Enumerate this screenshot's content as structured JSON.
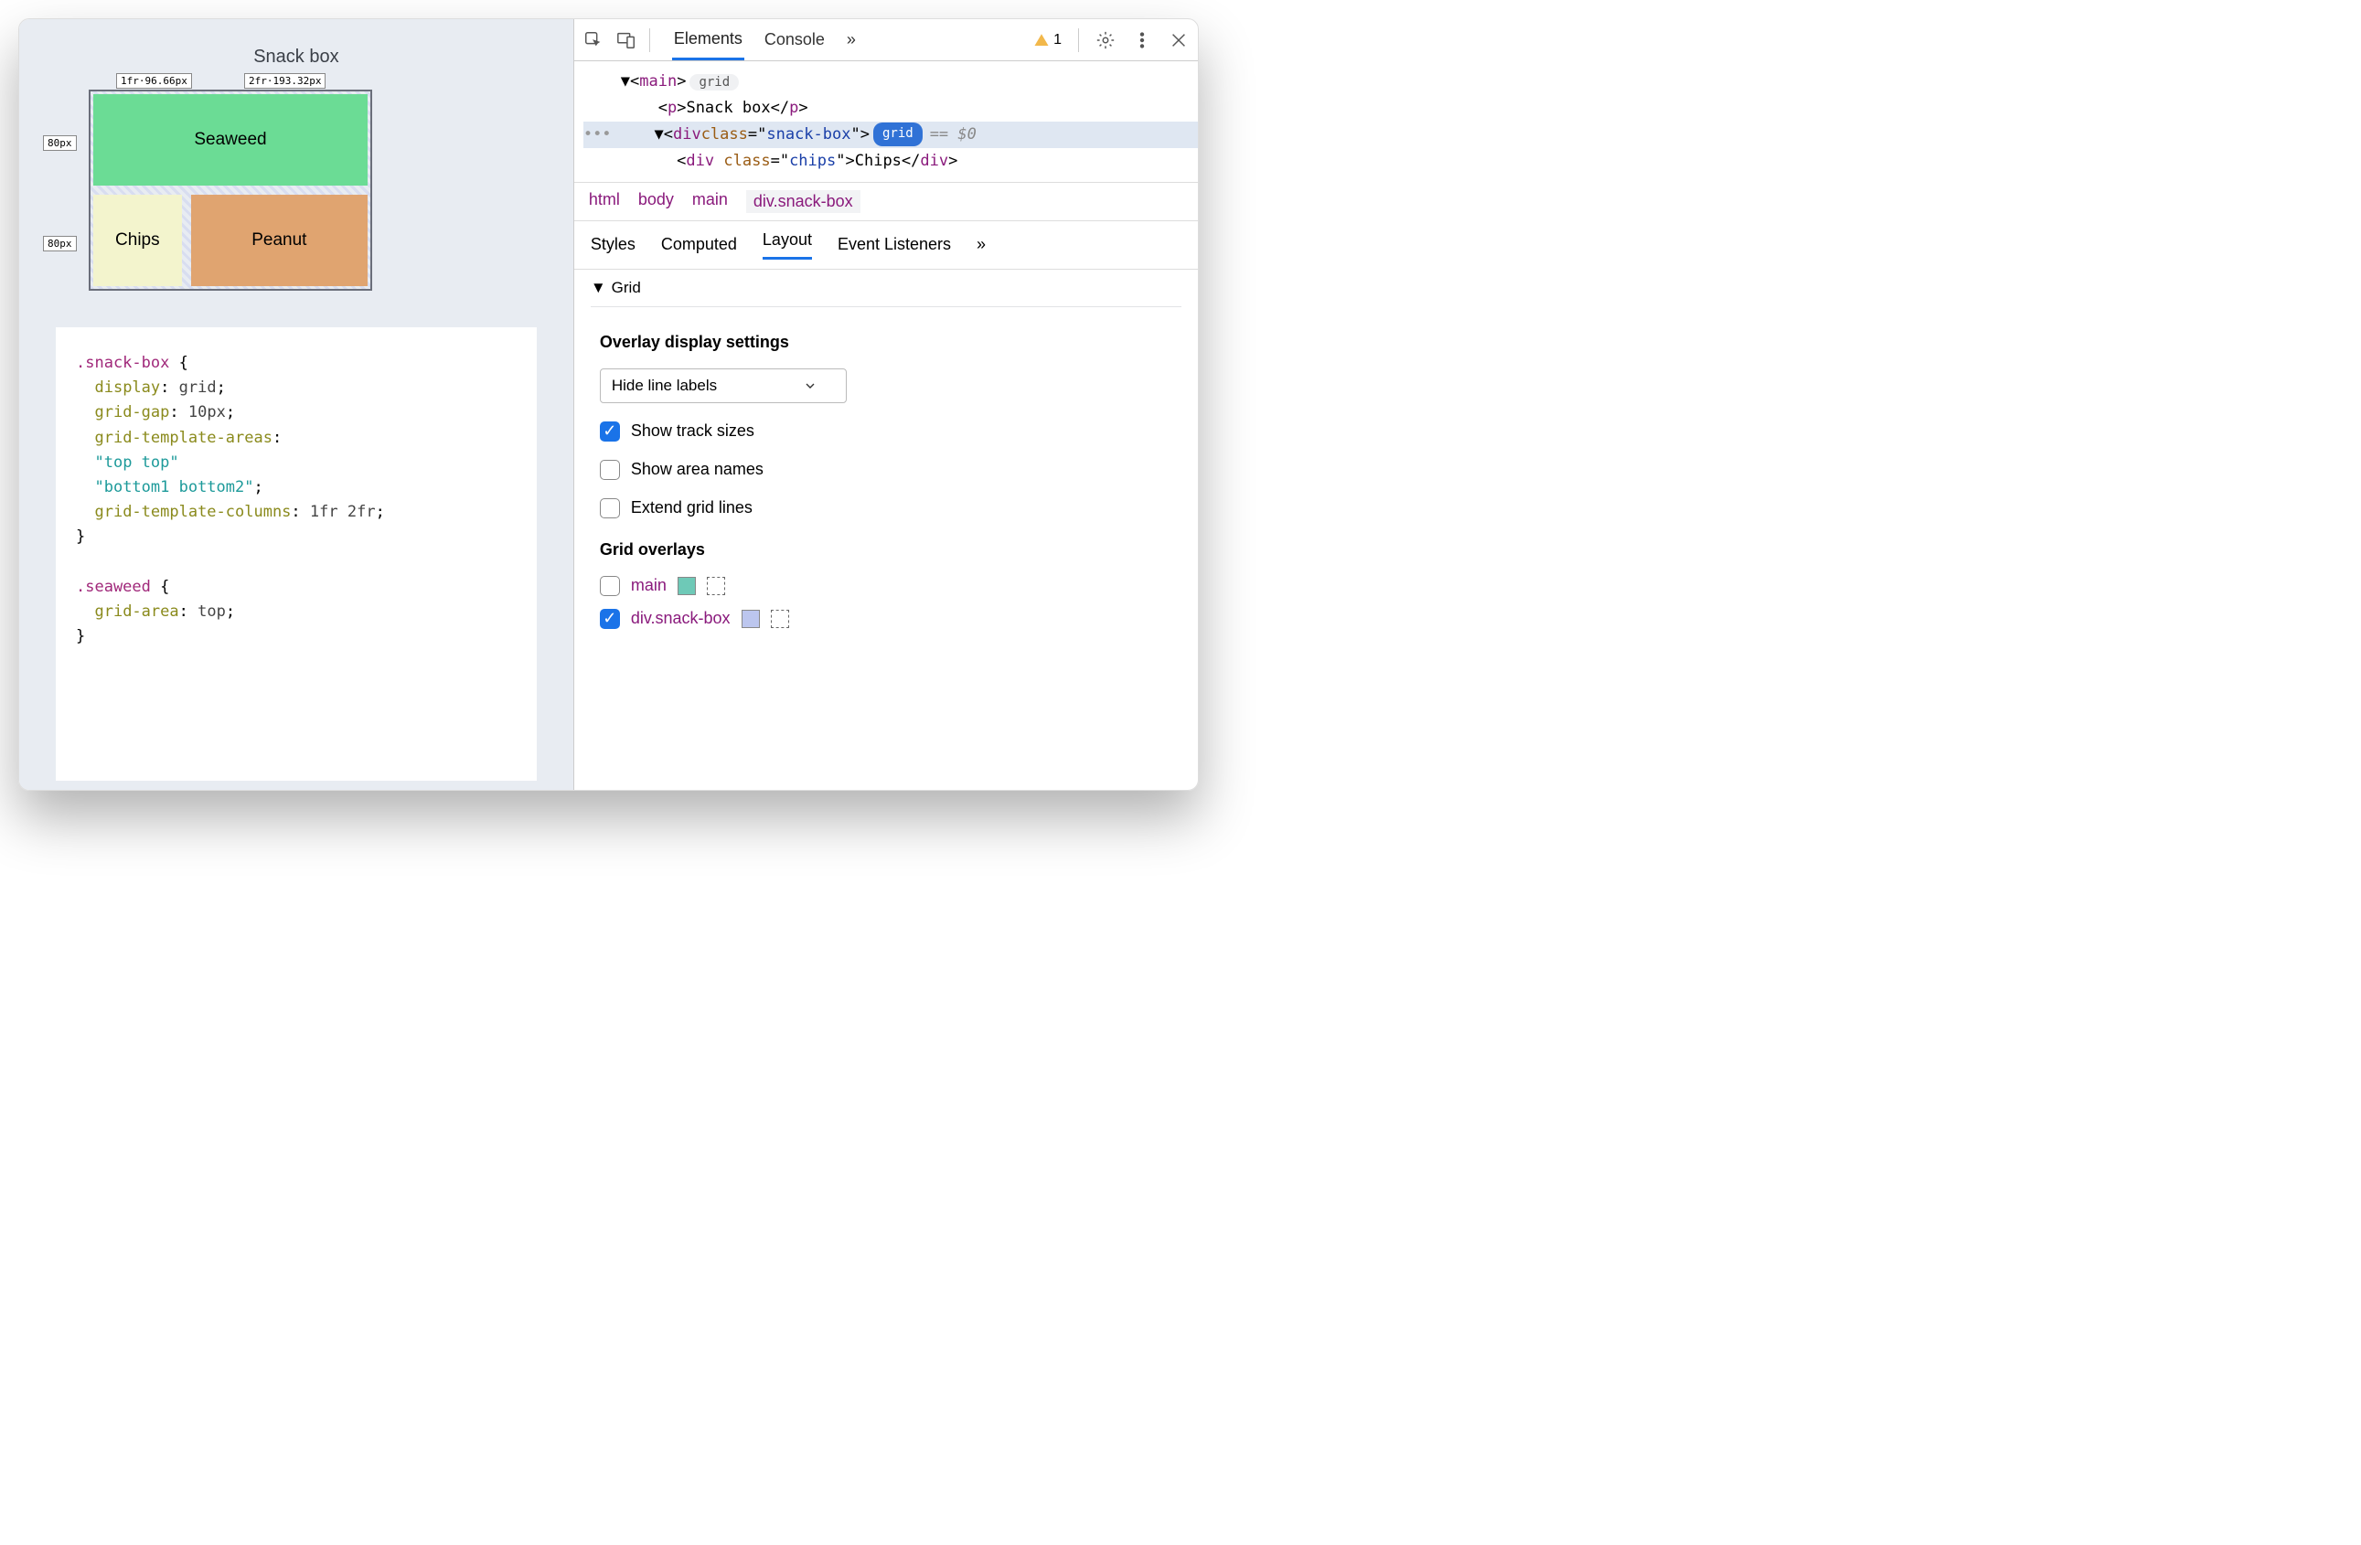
{
  "preview": {
    "title": "Snack box",
    "tracks": {
      "col1": "1fr·96.66px",
      "col2": "2fr·193.32px",
      "row1": "80px",
      "row2": "80px"
    },
    "cells": {
      "seaweed": "Seaweed",
      "chips": "Chips",
      "peanut": "Peanut"
    }
  },
  "css": {
    "selector1": ".snack-box",
    "l1p": "display",
    "l1v": "grid",
    "l2p": "grid-gap",
    "l2v": "10px",
    "l3p": "grid-template-areas",
    "l4": "\"top top\"",
    "l5": "\"bottom1 bottom2\"",
    "l6p": "grid-template-columns",
    "l6v": "1fr 2fr",
    "selector2": ".seaweed",
    "l7p": "grid-area",
    "l7v": "top"
  },
  "toolbar": {
    "tabs": {
      "elements": "Elements",
      "console": "Console"
    },
    "more": "»",
    "warn_count": "1"
  },
  "dom": {
    "main_open": "main",
    "main_badge": "grid",
    "p_text": "Snack box",
    "div_class": "snack-box",
    "div_badge": "grid",
    "selvar": "== $0",
    "child_class": "chips",
    "child_text": "Chips"
  },
  "crumbs": {
    "c1": "html",
    "c2": "body",
    "c3": "main",
    "c4": "div.snack-box"
  },
  "panetabs": {
    "t1": "Styles",
    "t2": "Computed",
    "t3": "Layout",
    "t4": "Event Listeners",
    "more": "»"
  },
  "grid_section": {
    "title": "Grid"
  },
  "overlay_settings": {
    "title": "Overlay display settings",
    "select": "Hide line labels",
    "opt1": "Show track sizes",
    "opt2": "Show area names",
    "opt3": "Extend grid lines"
  },
  "grid_overlays": {
    "title": "Grid overlays",
    "row1": "main",
    "row2": "div.snack-box"
  }
}
